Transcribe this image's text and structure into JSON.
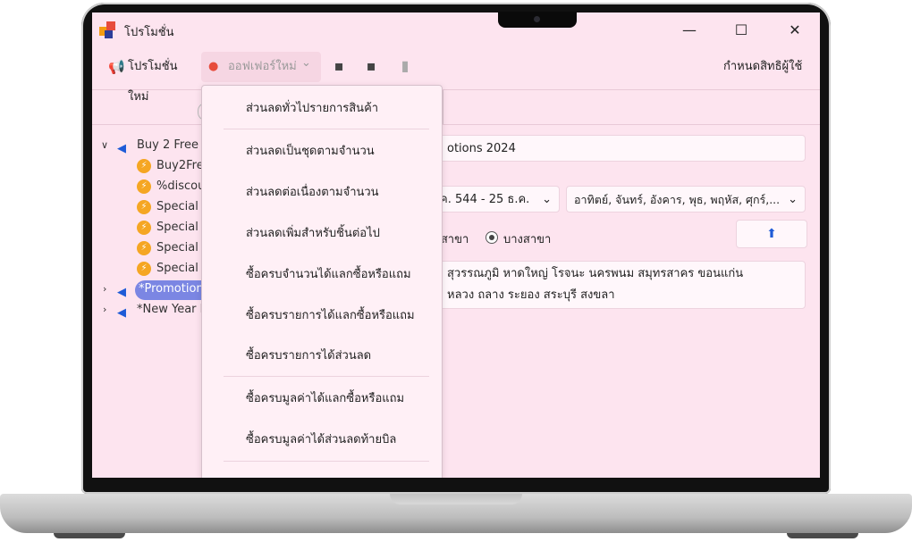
{
  "window": {
    "title": "โปรโมชั่น",
    "minimize_glyph": "—",
    "maximize_glyph": "☐",
    "close_glyph": "✕"
  },
  "toolbar": {
    "new_promotion_label": "โปรโมชั่นใหม่",
    "new_offer_label": "ออฟเฟอร์ใหม่",
    "new_offer_chevron": "⌄",
    "save_icon": "floppy-disk-icon",
    "save_as_icon": "floppy-disk-icon",
    "delete_icon": "trash-icon",
    "permissions_label": "กำหนดสิทธิผู้ใช้"
  },
  "tree": {
    "items": [
      {
        "label": "Buy 2 Free 1",
        "level": 0,
        "expanded": true
      },
      {
        "label": "Buy2Free",
        "level": 1
      },
      {
        "label": "%discou",
        "level": 1
      },
      {
        "label": "Special 1",
        "level": 1
      },
      {
        "label": "Special 2",
        "level": 1
      },
      {
        "label": "Special 3",
        "level": 1
      },
      {
        "label": "Special 4",
        "level": 1
      },
      {
        "label": "*Promotion",
        "level": 0,
        "expanded": false,
        "selected": true
      },
      {
        "label": "*New Year P",
        "level": 0,
        "expanded": false
      }
    ]
  },
  "detail": {
    "promotion_name": "otions 2024",
    "date_range": "ค. 544  -  25 ธ.ค.",
    "days": "อาทิตย์, จันทร์, อังคาร, พุธ, พฤหัส, ศุกร์,...",
    "branch_option_all": "กสาขา",
    "branch_option_some": "บางสาขา",
    "branches_line1": "สุวรรณภูมิ   หาดใหญ่   โรจนะ   นครพนม   สมุทรสาคร   ขอนแก่น",
    "branches_line2": "หลวง   ถลาง   ระยอง   สระบุรี   สงขลา"
  },
  "offer_menu": {
    "items": [
      "ส่วนลดทั่วไปรายการสินค้า",
      "ส่วนลดเป็นชุดตามจำนวน",
      "ส่วนลดต่อเนื่องตามจำนวน",
      "ส่วนลดเพิ่มสำหรับชิ้นต่อไป",
      "ซื้อครบจำนวนได้แลกซื้อหรือแถม",
      "ซื้อครบรายการได้แลกซื้อหรือแถม",
      "ซื้อครบรายการได้ส่วนลด",
      "ซื้อครบมูลค่าได้แลกซื้อหรือแถม",
      "ซื้อครบมูลค่าได้ส่วนลดท้ายบิล"
    ]
  },
  "colors": {
    "window_bg": "#fde4ef",
    "selection": "#7b86e3",
    "accent_blue": "#1e5bd7",
    "bolt_orange": "#f5a623"
  }
}
